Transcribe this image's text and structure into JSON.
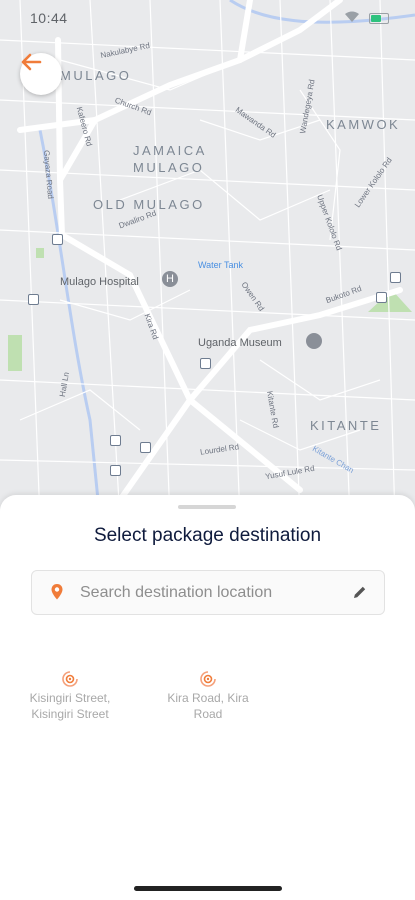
{
  "status_bar": {
    "time": "10:44"
  },
  "map": {
    "areas": [
      "MULAGO",
      "JAMAICA",
      "MULAGO",
      "OLD MULAGO",
      "KAMWOK",
      "KITANTE"
    ],
    "roads": [
      "Nakulabye Rd",
      "Church Rd",
      "Kafeero Rd",
      "Gayaza Road",
      "Dwaliro Rd",
      "Mawanda Rd",
      "Wandegeya Rd",
      "Upper Kololo Rd",
      "Lower Kololo Rd",
      "Bukoto Rd",
      "Owen Rd",
      "Kira Rd",
      "Hall Ln",
      "Kitante Rd",
      "Lourdel Rd",
      "Yusuf Lule Rd",
      "Kitante Chan"
    ],
    "pois": {
      "hospital": "Mulago Hospital",
      "water": "Water Tank",
      "museum": "Uganda Museum"
    }
  },
  "sheet": {
    "title": "Select package destination",
    "search_placeholder": "Search destination location",
    "recent": [
      {
        "label": "Kisingiri Street, Kisingiri Street"
      },
      {
        "label": "Kira Road, Kira Road"
      }
    ]
  },
  "colors": {
    "accent": "#f07c3a",
    "title": "#0f1b3d",
    "map_bg": "#e9eaec"
  },
  "icons": {
    "back": "arrow-left-icon",
    "pin": "location-pin-icon",
    "edit": "pencil-icon",
    "recent": "recent-location-icon"
  }
}
